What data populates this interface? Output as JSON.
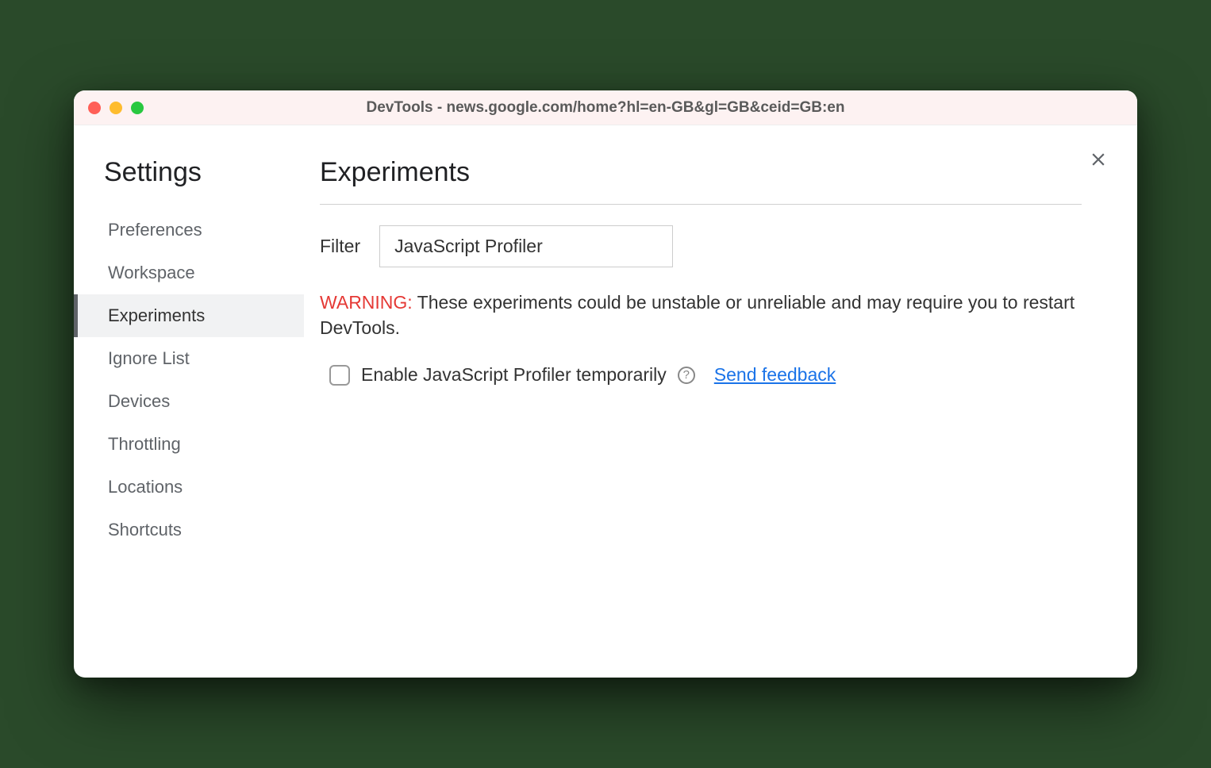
{
  "window": {
    "title": "DevTools - news.google.com/home?hl=en-GB&gl=GB&ceid=GB:en"
  },
  "sidebar": {
    "title": "Settings",
    "items": [
      {
        "label": "Preferences"
      },
      {
        "label": "Workspace"
      },
      {
        "label": "Experiments"
      },
      {
        "label": "Ignore List"
      },
      {
        "label": "Devices"
      },
      {
        "label": "Throttling"
      },
      {
        "label": "Locations"
      },
      {
        "label": "Shortcuts"
      }
    ]
  },
  "main": {
    "title": "Experiments",
    "filter_label": "Filter",
    "filter_value": "JavaScript Profiler",
    "warning_label": "WARNING:",
    "warning_text": " These experiments could be unstable or unreliable and may require you to restart DevTools.",
    "experiment_label": "Enable JavaScript Profiler temporarily",
    "help_glyph": "?",
    "feedback_link": "Send feedback"
  }
}
